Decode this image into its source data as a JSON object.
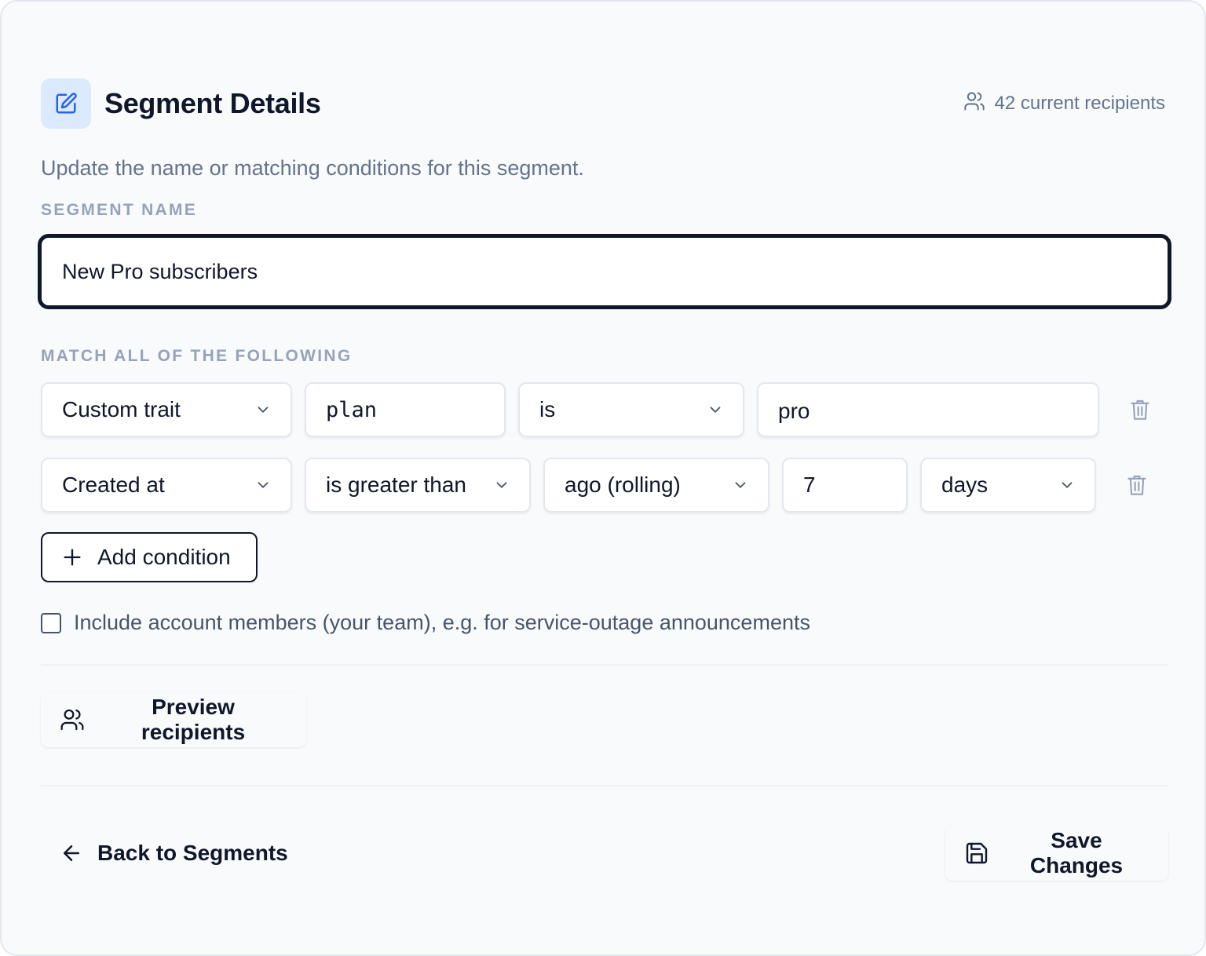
{
  "header": {
    "title": "Segment Details",
    "recipients_count": "42 current recipients",
    "subtitle": "Update the name or matching conditions for this segment."
  },
  "name_section": {
    "label": "SEGMENT NAME",
    "value": "New Pro subscribers"
  },
  "conditions_section": {
    "label": "MATCH ALL OF THE FOLLOWING",
    "rows": [
      {
        "field": "Custom trait",
        "trait_key": "plan",
        "operator": "is",
        "value": "pro"
      },
      {
        "field": "Created at",
        "operator": "is greater than",
        "mode": "ago (rolling)",
        "amount": "7",
        "unit": "days"
      }
    ],
    "add_label": "Add condition"
  },
  "include_members": {
    "label": "Include account members (your team), e.g. for service-outage announcements",
    "checked": false
  },
  "preview_label": "Preview recipients",
  "footer": {
    "back_label": "Back to Segments",
    "save_label": "Save Changes"
  },
  "colors": {
    "accent": "#2563eb",
    "accent_bg": "#dbeafe",
    "text": "#0f172a",
    "muted": "#64748b",
    "label": "#94a3b8"
  },
  "icons": [
    "edit-icon",
    "users-icon",
    "chevron-down-icon",
    "trash-icon",
    "plus-icon",
    "arrow-left-icon",
    "save-icon"
  ]
}
